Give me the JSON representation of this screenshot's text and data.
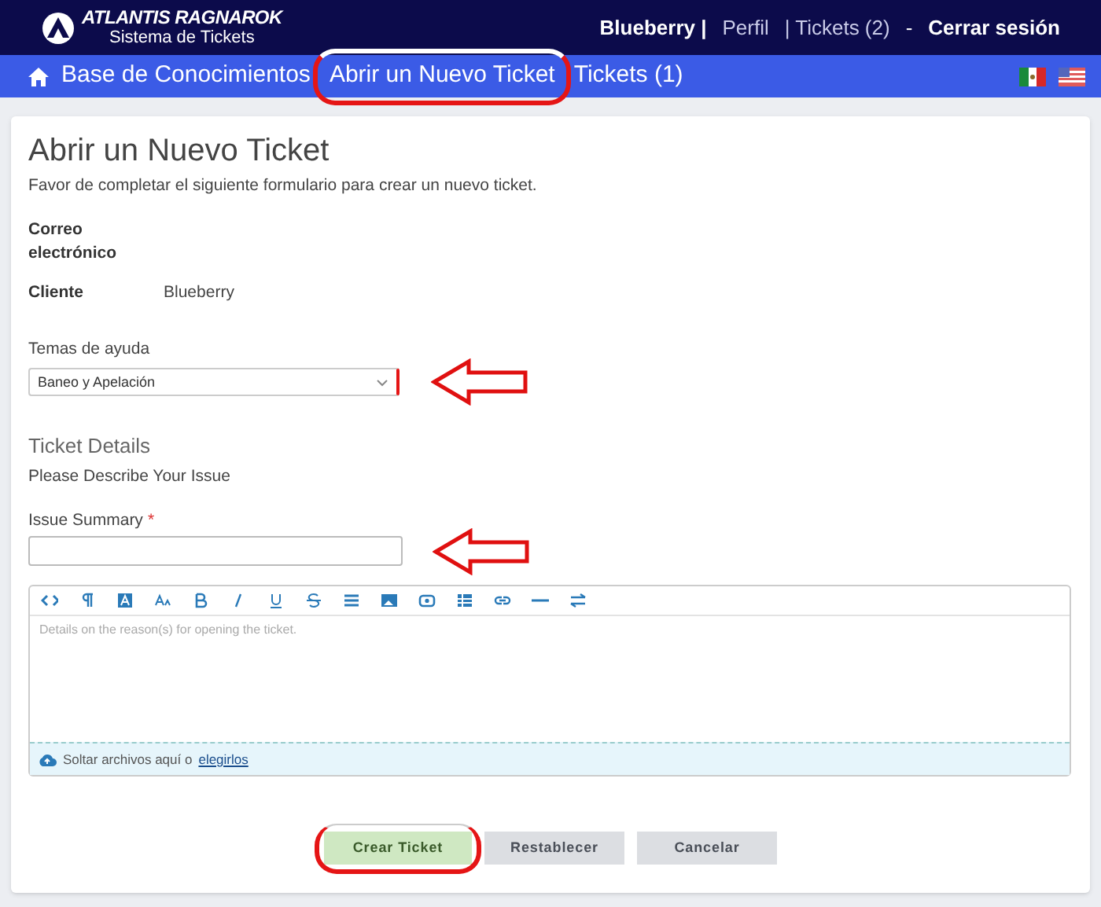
{
  "header": {
    "brand": "ATLANTIS RAGNAROK",
    "subtitle": "Sistema de Tickets",
    "user_links": [
      {
        "label": "Blueberry |",
        "kind": "user"
      },
      {
        "label": "Perfil",
        "kind": "link"
      },
      {
        "label": "| Tickets (2)",
        "kind": "link"
      },
      {
        "label": "-",
        "kind": "sep"
      },
      {
        "label": "Cerrar sesión",
        "kind": "user"
      }
    ]
  },
  "nav": {
    "items": [
      {
        "label": "Base de Conocimientos",
        "home": true,
        "highlighted": false
      },
      {
        "label": "Abrir un Nuevo Ticket",
        "home": false,
        "highlighted": true
      },
      {
        "label": "Tickets (1)",
        "home": false,
        "highlighted": false
      }
    ]
  },
  "form": {
    "title": "Abrir un Nuevo Ticket",
    "intro": "Favor de completar el siguiente formulario para crear un nuevo ticket.",
    "info": [
      {
        "label": "Correo electrónico"
      },
      {
        "label": "Cliente",
        "value": "Blueberry"
      }
    ],
    "help_topic": {
      "label": "Temas de ayuda",
      "value": "Baneo y Apelación",
      "arrow": true
    },
    "section_title": "Ticket Details",
    "section_subtitle": "Please Describe Your Issue",
    "summary": {
      "label": "Issue Summary",
      "required_mark": "*",
      "arrow": true
    },
    "editor": {
      "placeholder": "Details on the reason(s) for opening the ticket.",
      "drop_text": "Soltar archivos aquí o",
      "drop_link": "elegirlos"
    },
    "buttons": [
      {
        "label": "Crear Ticket",
        "kind": "primary",
        "highlighted": true
      },
      {
        "label": "Restablecer",
        "kind": "secondary",
        "highlighted": false
      },
      {
        "label": "Cancelar",
        "kind": "secondary",
        "highlighted": false
      }
    ]
  }
}
